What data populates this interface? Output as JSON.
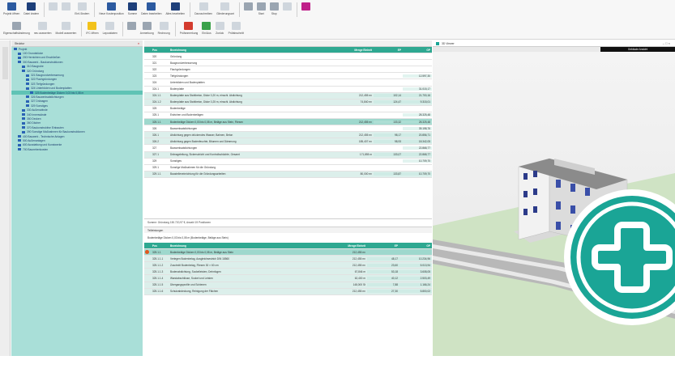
{
  "ribbon": {
    "row1": [
      {
        "label": "Projekt öffnen",
        "icon": "save-icon",
        "color": "blue"
      },
      {
        "label": "Datei ändern",
        "icon": "floppy-icon",
        "color": "navy"
      },
      {
        "label": "",
        "icon": "undo-icon",
        "color": "lgray"
      },
      {
        "label": "",
        "icon": "redo-icon",
        "color": "lgray"
      },
      {
        "label": "Einf./Ändern",
        "icon": "cursor-icon",
        "color": "lgray"
      },
      {
        "label": "Neue Kostenposition",
        "icon": "table-icon",
        "color": "blue"
      },
      {
        "label": "Summe",
        "icon": "sum-icon",
        "color": "navy"
      },
      {
        "label": "Daten bearbeiten",
        "icon": "grid-icon",
        "color": "blue"
      },
      {
        "label": "Alles bearbeiten",
        "icon": "chart-icon",
        "color": "navy"
      },
      {
        "label": "Dazuschreiben",
        "icon": "pointer-icon",
        "color": "lgray"
      },
      {
        "label": "Gliederungsart",
        "icon": "move-icon",
        "color": "lgray"
      },
      {
        "label": "",
        "icon": "list-icon",
        "color": "gray"
      },
      {
        "label": "Start",
        "icon": "settings-icon",
        "color": "gray"
      },
      {
        "label": "Stop",
        "icon": "settings2-icon",
        "color": "gray"
      },
      {
        "label": "",
        "icon": "view-icon",
        "color": "lgray"
      },
      {
        "label": "",
        "icon": "pink-doc-icon",
        "color": "pink"
      }
    ],
    "row2": [
      {
        "label": "Eigenschaftsänderung",
        "icon": "properties-icon",
        "color": "gray"
      },
      {
        "label": "neu auswerten",
        "icon": "refresh-icon",
        "color": "lgray"
      },
      {
        "label": "Modell auswerten",
        "icon": "model-icon",
        "color": "lgray"
      },
      {
        "label": "IFC öffnen",
        "icon": "ifc-icon",
        "color": "yel"
      },
      {
        "label": "Layoutdaten",
        "icon": "layout-icon",
        "color": "lgray"
      },
      {
        "label": "",
        "icon": "doc-icon",
        "color": "gray"
      },
      {
        "label": "Anmerkung",
        "icon": "edit-icon",
        "color": "gray"
      },
      {
        "label": "Rechnung",
        "icon": "invoice-icon",
        "color": "lgray"
      },
      {
        "label": "Prüfanmerkung",
        "icon": "check-icon",
        "color": "red"
      },
      {
        "label": "Ein/Aus",
        "icon": "toggle-icon",
        "color": "green"
      },
      {
        "label": "Zurück",
        "icon": "back-icon",
        "color": "lgray"
      },
      {
        "label": "Prüfabschnitt",
        "icon": "section-icon",
        "color": "lgray"
      }
    ]
  },
  "tree": {
    "header": "Struktur",
    "nodes": [
      {
        "label": "Projekt",
        "indent": 0
      },
      {
        "label": "100 Grundstücke",
        "indent": 1
      },
      {
        "label": "200 Herrichten und Erschließen",
        "indent": 1
      },
      {
        "label": "300 Bauwerk - Baukonstruktionen",
        "indent": 1
      },
      {
        "label": "310 Baugrube",
        "indent": 2
      },
      {
        "label": "320 Gründung",
        "indent": 2
      },
      {
        "label": "321 Baugrundverbesserung",
        "indent": 3
      },
      {
        "label": "322 Flachgründungen",
        "indent": 3
      },
      {
        "label": "323 Tiefgründungen",
        "indent": 3
      },
      {
        "label": "324 Unterböden und Bodenplatten",
        "indent": 3
      },
      {
        "label": "325 Bodenbeläge Dicken 0,03 bis 0,08 m",
        "indent": 4,
        "sel": true
      },
      {
        "label": "326 Bauwerksabdichtungen",
        "indent": 3
      },
      {
        "label": "327 Dränagen",
        "indent": 3
      },
      {
        "label": "329 Sonstiges",
        "indent": 3
      },
      {
        "label": "330 Außenwände",
        "indent": 2
      },
      {
        "label": "340 Innenwände",
        "indent": 2
      },
      {
        "label": "350 Decken",
        "indent": 2
      },
      {
        "label": "360 Dächer",
        "indent": 2
      },
      {
        "label": "370 Baukonstruktive Einbauten",
        "indent": 2
      },
      {
        "label": "390 Sonstige Maßnahmen für Baukonstruktionen",
        "indent": 2
      },
      {
        "label": "400 Bauwerk - Technische Anlagen",
        "indent": 1
      },
      {
        "label": "500 Außenanlagen",
        "indent": 1
      },
      {
        "label": "600 Ausstattung und Kunstwerke",
        "indent": 1
      },
      {
        "label": "700 Baunebenkosten",
        "indent": 1
      }
    ]
  },
  "table": {
    "header": [
      "Pos",
      "Bezeichnung",
      "Menge Einheit",
      "EP",
      "GP"
    ],
    "rows": [
      {
        "pos": "320",
        "text": "Gründung",
        "qty": "",
        "ep": "",
        "gp": "",
        "style": ""
      },
      {
        "pos": "321",
        "text": "Baugrundverbesserung",
        "qty": "",
        "ep": "",
        "gp": "",
        "style": ""
      },
      {
        "pos": "322",
        "text": "Flachgründungen",
        "qty": "",
        "ep": "",
        "gp": "",
        "style": ""
      },
      {
        "pos": "323",
        "text": "Tiefgründungen",
        "qty": "",
        "ep": "",
        "gp": "12.597,30",
        "style": ""
      },
      {
        "pos": "324",
        "text": "Unterböden und Bodenplatten",
        "qty": "",
        "ep": "",
        "gp": "",
        "style": ""
      },
      {
        "pos": "324.1",
        "text": "Bodenplatte",
        "qty": "",
        "ep": "",
        "gp": "31.015,17",
        "style": ""
      },
      {
        "pos": "324.1.1",
        "text": "Bodenplatte aus Stahlbeton, Dicke 0,20 m, einschl. Abdichtung",
        "qty": "212,455 m²",
        "ep": "102,14",
        "gp": "21.700,16",
        "style": "tint"
      },
      {
        "pos": "324.1.2",
        "text": "Bodenplatte aus Stahlbeton, Dicke 0,25 m, einschl. Abdichtung",
        "qty": "74,840 m²",
        "ep": "124,47",
        "gp": "9.315,01",
        "style": "tint"
      },
      {
        "pos": "325",
        "text": "Bodenbeläge",
        "qty": "",
        "ep": "",
        "gp": "",
        "style": ""
      },
      {
        "pos": "325.1",
        "text": "Estrichen und Bodenbelägen",
        "qty": "",
        "ep": "",
        "gp": "28.325,48",
        "style": ""
      },
      {
        "pos": "325.1.1",
        "text": "Bodenbeläge Dicken 0,03 bis 0,08 m, Beläge aus Stein, Fliesen",
        "qty": "212,455 m²",
        "ep": "133,32",
        "gp": "28.325,48",
        "style": "hi"
      },
      {
        "pos": "326",
        "text": "Bauwerksabdichtungen",
        "qty": "",
        "ep": "",
        "gp": "39.198,76",
        "style": ""
      },
      {
        "pos": "326.1",
        "text": "Abdichtung gegen drückendes Wasser, Bahnen, Beton",
        "qty": "212,455 m²",
        "ep": "98,17",
        "gp": "20.856,71",
        "style": "tint"
      },
      {
        "pos": "326.2",
        "text": "Abdichtung gegen Bodenfeuchte, Bitumen und Dämmung",
        "qty": "185,407 m²",
        "ep": "98,93",
        "gp": "18.342,05",
        "style": "tint"
      },
      {
        "pos": "327",
        "text": "Bauwerksabdichtungen",
        "qty": "",
        "ep": "",
        "gp": "22.868,77",
        "style": ""
      },
      {
        "pos": "327.1",
        "text": "Dränageleitung, Sickerschicht und Kontrollschächte, Gesamt",
        "qty": "171,855 m",
        "ep": "133,07",
        "gp": "22.868,77",
        "style": "tint"
      },
      {
        "pos": "329",
        "text": "Sonstiges",
        "qty": "",
        "ep": "",
        "gp": "10.709,70",
        "style": ""
      },
      {
        "pos": "329.1",
        "text": "Sonstige Maßnahmen für die Gründung",
        "qty": "",
        "ep": "",
        "gp": "",
        "style": ""
      },
      {
        "pos": "329.1.1",
        "text": "Baustelleneinrichtung für die Gründungsarbeiten",
        "qty": "80,000 m²",
        "ep": "133,87",
        "gp": "10.709,70",
        "style": "tint"
      }
    ]
  },
  "note": "Summe: Gründung 150.720,97 €, Anzahl 19 Positionen",
  "sub": {
    "title": "Teilleistungen",
    "info": "Bodenbeläge Dicken 0,03 bis 0,08 m (Bodenbeläge, Beläge aus Stein)",
    "header": [
      "Pos",
      "Bezeichnung",
      "Menge Einheit",
      "EP",
      "GP"
    ],
    "rows": [
      {
        "pos": "325.1.1",
        "text": "Bodenbeläge Dicken 0,03 bis 0,08 m, Beläge aus Stein",
        "qty": "212,455 m²",
        "ep": "",
        "gp": "",
        "style": "hi",
        "dot": true
      },
      {
        "pos": "325.1.1.1",
        "text": "Verlegen Bodenbelag, Ausgleichsestrich DIN 18560",
        "qty": "212,455 m²",
        "ep": "48,17",
        "gp": "10.234,96",
        "style": "tint"
      },
      {
        "pos": "325.1.1.2",
        "text": "Zuschnitt Bodenbelag, Fliesen 30 × 60 cm",
        "qty": "212,455 m²",
        "ep": "23,60",
        "gp": "5.013,94",
        "style": "tint"
      },
      {
        "pos": "325.1.1.3",
        "text": "Bodenabdichtung, Sockelleisten, Dehnfugen",
        "qty": "67,846 m",
        "ep": "53,18",
        "gp": "3.608,05",
        "style": "tint"
      },
      {
        "pos": "325.1.1.4",
        "text": "Wandabschlüsse, Sockel und Leisten",
        "qty": "62,400 m",
        "ep": "40,12",
        "gp": "2.503,49",
        "style": "tint"
      },
      {
        "pos": "325.1.1.5",
        "text": "Übergangsprofile und Schienen",
        "qty": "148,000 St",
        "ep": "7,88",
        "gp": "1.166,24",
        "style": "tint"
      },
      {
        "pos": "325.1.1.6",
        "text": "Schutzabdeckung, Reinigung der Flächen",
        "qty": "212,455 m²",
        "ep": "27,30",
        "gp": "5.800,02",
        "style": "tint"
      }
    ]
  },
  "viewer": {
    "title": "3D Viewer",
    "label": "Gebäude Ansicht",
    "controls": "–  □  ×"
  },
  "badge": {
    "icon": "add-icon",
    "color": "#1aa596"
  }
}
